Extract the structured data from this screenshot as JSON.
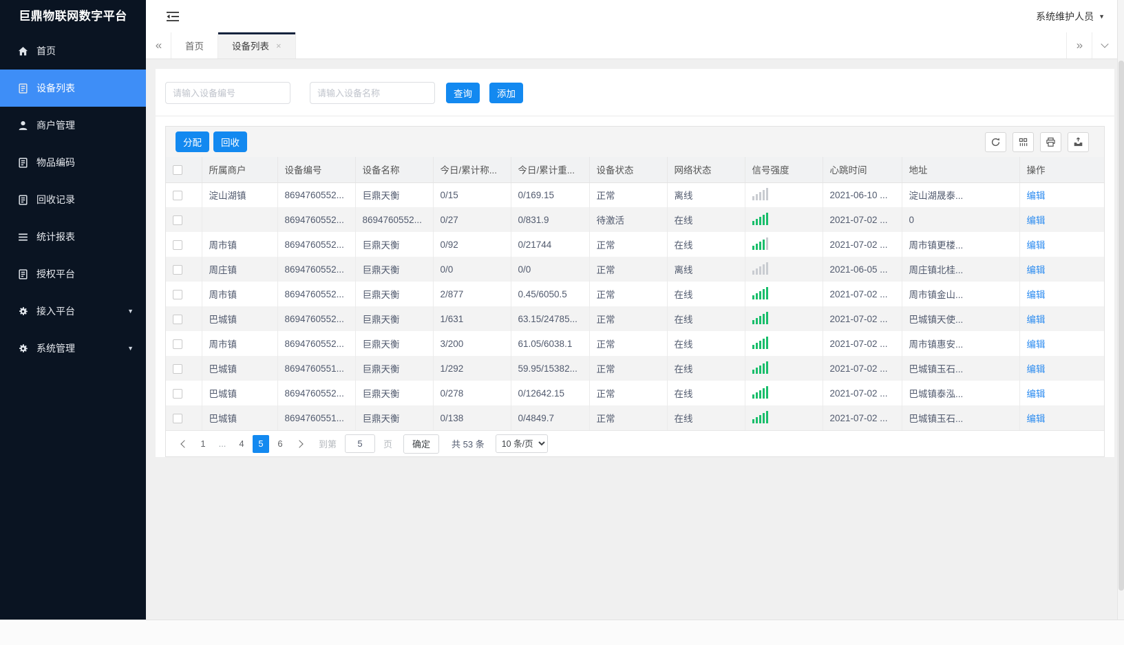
{
  "colors": {
    "accent": "#1389f0",
    "sidebar_bg": "#0a1422",
    "sidebar_active": "#3e8ef7",
    "green": "#19be6b",
    "red": "#ed3f14",
    "link": "#2d8cf0"
  },
  "sidebar": {
    "title": "巨鼎物联网数字平台",
    "items": [
      {
        "name": "home",
        "label": "首页",
        "icon": "home-icon",
        "active": false,
        "arrow": false
      },
      {
        "name": "device-list",
        "label": "设备列表",
        "icon": "doc-icon",
        "active": true,
        "arrow": false
      },
      {
        "name": "merchant-mgmt",
        "label": "商户管理",
        "icon": "user-icon",
        "active": false,
        "arrow": false
      },
      {
        "name": "item-code",
        "label": "物品编码",
        "icon": "doc-icon",
        "active": false,
        "arrow": false
      },
      {
        "name": "recycle-records",
        "label": "回收记录",
        "icon": "doc-icon",
        "active": false,
        "arrow": false
      },
      {
        "name": "stat-report",
        "label": "统计报表",
        "icon": "menu-lines-icon",
        "active": false,
        "arrow": false
      },
      {
        "name": "auth-platform",
        "label": "授权平台",
        "icon": "doc-icon",
        "active": false,
        "arrow": false
      },
      {
        "name": "access-platform",
        "label": "接入平台",
        "icon": "gear-icon",
        "active": false,
        "arrow": true
      },
      {
        "name": "system-mgmt",
        "label": "系统管理",
        "icon": "gear-icon",
        "active": false,
        "arrow": true
      }
    ],
    "submenu_arrow": "▼"
  },
  "topbar": {
    "user_role": "系统维护人员",
    "dropdown_arrow": "▼"
  },
  "tabbar": {
    "scroll_left": "«",
    "scroll_right": "»",
    "tabs": [
      {
        "label": "首页",
        "active": false,
        "close": ""
      },
      {
        "label": "设备列表",
        "active": true,
        "close": "×"
      }
    ]
  },
  "search": {
    "device_no_placeholder": "请输入设备编号",
    "device_name_placeholder": "请输入设备名称",
    "query_label": "查询",
    "add_label": "添加"
  },
  "toolbar": {
    "assign_label": "分配",
    "recycle_label": "回收",
    "icons": [
      "refresh-icon",
      "columns-icon",
      "print-icon",
      "export-icon"
    ]
  },
  "table": {
    "headers": [
      "所属商户",
      "设备编号",
      "设备名称",
      "今日/累计称...",
      "今日/累计重...",
      "设备状态",
      "网络状态",
      "信号强度",
      "心跳时间",
      "地址",
      "操作"
    ],
    "edit_label": "编辑",
    "rows": [
      {
        "merchant": "淀山湖镇",
        "device_no": "8694760552...",
        "device_name": "巨鼎天衡",
        "today_count": "0/15",
        "today_weight": "0/169.15",
        "status": "正常",
        "network": "离线",
        "online": false,
        "signal": 0,
        "heartbeat": "2021-06-10 ...",
        "address": "淀山湖晟泰..."
      },
      {
        "merchant": "",
        "device_no": "8694760552...",
        "device_name": "8694760552...",
        "today_count": "0/27",
        "today_weight": "0/831.9",
        "status": "待激活",
        "network": "在线",
        "online": true,
        "signal": 5,
        "heartbeat": "2021-07-02 ...",
        "address": "0"
      },
      {
        "merchant": "周市镇",
        "device_no": "8694760552...",
        "device_name": "巨鼎天衡",
        "today_count": "0/92",
        "today_weight": "0/21744",
        "status": "正常",
        "network": "在线",
        "online": true,
        "signal": 4,
        "heartbeat": "2021-07-02 ...",
        "address": "周市镇更楼..."
      },
      {
        "merchant": "周庄镇",
        "device_no": "8694760552...",
        "device_name": "巨鼎天衡",
        "today_count": "0/0",
        "today_weight": "0/0",
        "status": "正常",
        "network": "离线",
        "online": false,
        "signal": 0,
        "heartbeat": "2021-06-05 ...",
        "address": "周庄镇北桂..."
      },
      {
        "merchant": "周市镇",
        "device_no": "8694760552...",
        "device_name": "巨鼎天衡",
        "today_count": "2/877",
        "today_weight": "0.45/6050.5",
        "status": "正常",
        "network": "在线",
        "online": true,
        "signal": 5,
        "heartbeat": "2021-07-02 ...",
        "address": "周市镇金山..."
      },
      {
        "merchant": "巴城镇",
        "device_no": "8694760552...",
        "device_name": "巨鼎天衡",
        "today_count": "1/631",
        "today_weight": "63.15/24785...",
        "status": "正常",
        "network": "在线",
        "online": true,
        "signal": 5,
        "heartbeat": "2021-07-02 ...",
        "address": "巴城镇天使..."
      },
      {
        "merchant": "周市镇",
        "device_no": "8694760552...",
        "device_name": "巨鼎天衡",
        "today_count": "3/200",
        "today_weight": "61.05/6038.1",
        "status": "正常",
        "network": "在线",
        "online": true,
        "signal": 5,
        "heartbeat": "2021-07-02 ...",
        "address": "周市镇惠安..."
      },
      {
        "merchant": "巴城镇",
        "device_no": "8694760551...",
        "device_name": "巨鼎天衡",
        "today_count": "1/292",
        "today_weight": "59.95/15382...",
        "status": "正常",
        "network": "在线",
        "online": true,
        "signal": 5,
        "heartbeat": "2021-07-02 ...",
        "address": "巴城镇玉石..."
      },
      {
        "merchant": "巴城镇",
        "device_no": "8694760552...",
        "device_name": "巨鼎天衡",
        "today_count": "0/278",
        "today_weight": "0/12642.15",
        "status": "正常",
        "network": "在线",
        "online": true,
        "signal": 5,
        "heartbeat": "2021-07-02 ...",
        "address": "巴城镇泰泓..."
      },
      {
        "merchant": "巴城镇",
        "device_no": "8694760551...",
        "device_name": "巨鼎天衡",
        "today_count": "0/138",
        "today_weight": "0/4849.7",
        "status": "正常",
        "network": "在线",
        "online": true,
        "signal": 5,
        "heartbeat": "2021-07-02 ...",
        "address": "巴城镇玉石..."
      }
    ]
  },
  "pagination": {
    "pages": [
      "1",
      "...",
      "4",
      "5",
      "6"
    ],
    "active_page": "5",
    "goto_label": "到第",
    "goto_value": "5",
    "page_word": "页",
    "confirm_label": "确定",
    "total_text": "共 53 条",
    "page_size_option": "10 条/页"
  }
}
